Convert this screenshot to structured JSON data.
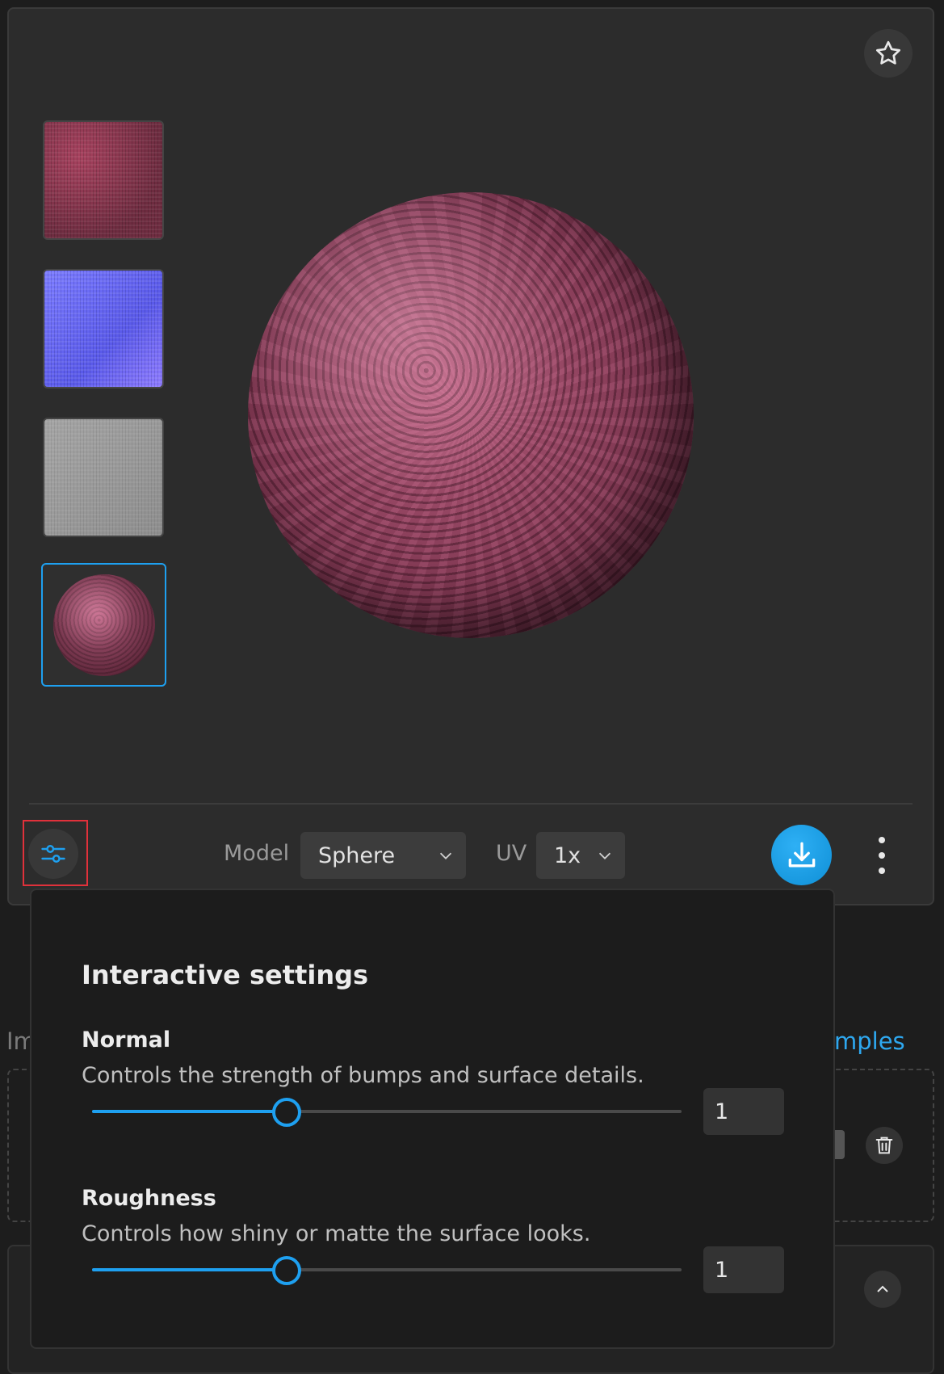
{
  "toolbar": {
    "model_label": "Model",
    "model_value": "Sphere",
    "uv_label": "UV",
    "uv_value": "1x"
  },
  "background": {
    "left_text": "Im",
    "right_link": "mples"
  },
  "popover": {
    "title": "Interactive settings",
    "settings": [
      {
        "name": "Normal",
        "description": "Controls the strength of bumps and surface details.",
        "value": "1",
        "slider_fraction": 0.33
      },
      {
        "name": "Roughness",
        "description": "Controls how shiny or matte the surface looks.",
        "value": "1",
        "slider_fraction": 0.33
      }
    ]
  },
  "colors": {
    "accent": "#1ea0f0",
    "highlight_frame": "#e0313b"
  },
  "icons": [
    "star-icon",
    "sliders-icon",
    "chevron-down-icon",
    "download-icon",
    "more-vertical-icon",
    "trash-icon",
    "chevron-up-icon"
  ]
}
